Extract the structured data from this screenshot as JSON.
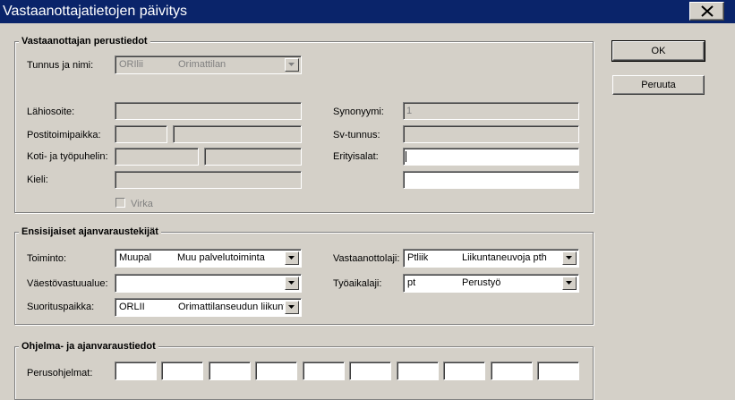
{
  "window": {
    "title": "Vastaanottajatietojen päivitys"
  },
  "buttons": {
    "ok": "OK",
    "cancel": "Peruuta"
  },
  "basic": {
    "legend": "Vastaanottajan perustiedot",
    "tunnus_label": "Tunnus ja nimi:",
    "tunnus_code": "ORIlii",
    "tunnus_name": "Orimattilan",
    "lahiosoite_label": "Lähiosoite:",
    "postitoimipaikka_label": "Postitoimipaikka:",
    "puhelin_label": "Koti- ja työpuhelin:",
    "kieli_label": "Kieli:",
    "virka_label": "Virka",
    "synonyymi_label": "Synonyymi:",
    "synonyymi_value": "1",
    "svtunnus_label": "Sv-tunnus:",
    "erityisalat_label": "Erityisalat:"
  },
  "primary": {
    "legend": "Ensisijaiset ajanvaraustekijät",
    "toiminto_label": "Toiminto:",
    "toiminto_code": "Muupal",
    "toiminto_name": "Muu palvelutoiminta",
    "vaesto_label": "Väestövastuualue:",
    "suoritus_label": "Suorituspaikka:",
    "suoritus_code": "ORLII",
    "suoritus_name": "Orimattilanseudun liikunt",
    "vastaanottolaji_label": "Vastaanottolaji:",
    "vastaanottolaji_code": "Ptliik",
    "vastaanottolaji_name": "Liikuntaneuvoja pth",
    "tyoaikalaji_label": "Työaikalaji:",
    "tyoaikalaji_code": "pt",
    "tyoaikalaji_name": "Perustyö"
  },
  "program": {
    "legend": "Ohjelma- ja ajanvaraustiedot",
    "perusohjelmat_label": "Perusohjelmat:"
  }
}
